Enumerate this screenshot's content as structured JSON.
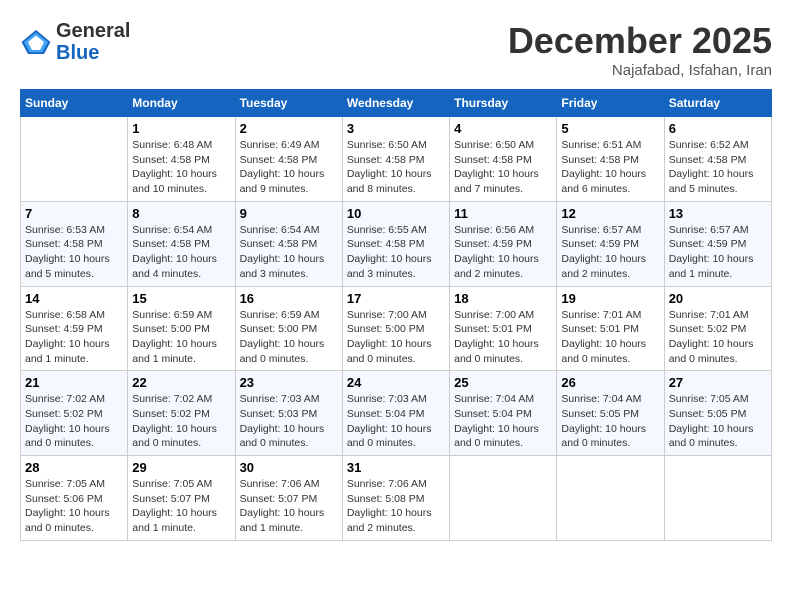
{
  "logo": {
    "general": "General",
    "blue": "Blue"
  },
  "title": "December 2025",
  "location": "Najafabad, Isfahan, Iran",
  "days_of_week": [
    "Sunday",
    "Monday",
    "Tuesday",
    "Wednesday",
    "Thursday",
    "Friday",
    "Saturday"
  ],
  "weeks": [
    [
      {
        "num": "",
        "sunrise": "",
        "sunset": "",
        "daylight": ""
      },
      {
        "num": "1",
        "sunrise": "6:48 AM",
        "sunset": "4:58 PM",
        "daylight": "10 hours and 10 minutes."
      },
      {
        "num": "2",
        "sunrise": "6:49 AM",
        "sunset": "4:58 PM",
        "daylight": "10 hours and 9 minutes."
      },
      {
        "num": "3",
        "sunrise": "6:50 AM",
        "sunset": "4:58 PM",
        "daylight": "10 hours and 8 minutes."
      },
      {
        "num": "4",
        "sunrise": "6:50 AM",
        "sunset": "4:58 PM",
        "daylight": "10 hours and 7 minutes."
      },
      {
        "num": "5",
        "sunrise": "6:51 AM",
        "sunset": "4:58 PM",
        "daylight": "10 hours and 6 minutes."
      },
      {
        "num": "6",
        "sunrise": "6:52 AM",
        "sunset": "4:58 PM",
        "daylight": "10 hours and 5 minutes."
      }
    ],
    [
      {
        "num": "7",
        "sunrise": "6:53 AM",
        "sunset": "4:58 PM",
        "daylight": "10 hours and 5 minutes."
      },
      {
        "num": "8",
        "sunrise": "6:54 AM",
        "sunset": "4:58 PM",
        "daylight": "10 hours and 4 minutes."
      },
      {
        "num": "9",
        "sunrise": "6:54 AM",
        "sunset": "4:58 PM",
        "daylight": "10 hours and 3 minutes."
      },
      {
        "num": "10",
        "sunrise": "6:55 AM",
        "sunset": "4:58 PM",
        "daylight": "10 hours and 3 minutes."
      },
      {
        "num": "11",
        "sunrise": "6:56 AM",
        "sunset": "4:59 PM",
        "daylight": "10 hours and 2 minutes."
      },
      {
        "num": "12",
        "sunrise": "6:57 AM",
        "sunset": "4:59 PM",
        "daylight": "10 hours and 2 minutes."
      },
      {
        "num": "13",
        "sunrise": "6:57 AM",
        "sunset": "4:59 PM",
        "daylight": "10 hours and 1 minute."
      }
    ],
    [
      {
        "num": "14",
        "sunrise": "6:58 AM",
        "sunset": "4:59 PM",
        "daylight": "10 hours and 1 minute."
      },
      {
        "num": "15",
        "sunrise": "6:59 AM",
        "sunset": "5:00 PM",
        "daylight": "10 hours and 1 minute."
      },
      {
        "num": "16",
        "sunrise": "6:59 AM",
        "sunset": "5:00 PM",
        "daylight": "10 hours and 0 minutes."
      },
      {
        "num": "17",
        "sunrise": "7:00 AM",
        "sunset": "5:00 PM",
        "daylight": "10 hours and 0 minutes."
      },
      {
        "num": "18",
        "sunrise": "7:00 AM",
        "sunset": "5:01 PM",
        "daylight": "10 hours and 0 minutes."
      },
      {
        "num": "19",
        "sunrise": "7:01 AM",
        "sunset": "5:01 PM",
        "daylight": "10 hours and 0 minutes."
      },
      {
        "num": "20",
        "sunrise": "7:01 AM",
        "sunset": "5:02 PM",
        "daylight": "10 hours and 0 minutes."
      }
    ],
    [
      {
        "num": "21",
        "sunrise": "7:02 AM",
        "sunset": "5:02 PM",
        "daylight": "10 hours and 0 minutes."
      },
      {
        "num": "22",
        "sunrise": "7:02 AM",
        "sunset": "5:02 PM",
        "daylight": "10 hours and 0 minutes."
      },
      {
        "num": "23",
        "sunrise": "7:03 AM",
        "sunset": "5:03 PM",
        "daylight": "10 hours and 0 minutes."
      },
      {
        "num": "24",
        "sunrise": "7:03 AM",
        "sunset": "5:04 PM",
        "daylight": "10 hours and 0 minutes."
      },
      {
        "num": "25",
        "sunrise": "7:04 AM",
        "sunset": "5:04 PM",
        "daylight": "10 hours and 0 minutes."
      },
      {
        "num": "26",
        "sunrise": "7:04 AM",
        "sunset": "5:05 PM",
        "daylight": "10 hours and 0 minutes."
      },
      {
        "num": "27",
        "sunrise": "7:05 AM",
        "sunset": "5:05 PM",
        "daylight": "10 hours and 0 minutes."
      }
    ],
    [
      {
        "num": "28",
        "sunrise": "7:05 AM",
        "sunset": "5:06 PM",
        "daylight": "10 hours and 0 minutes."
      },
      {
        "num": "29",
        "sunrise": "7:05 AM",
        "sunset": "5:07 PM",
        "daylight": "10 hours and 1 minute."
      },
      {
        "num": "30",
        "sunrise": "7:06 AM",
        "sunset": "5:07 PM",
        "daylight": "10 hours and 1 minute."
      },
      {
        "num": "31",
        "sunrise": "7:06 AM",
        "sunset": "5:08 PM",
        "daylight": "10 hours and 2 minutes."
      },
      {
        "num": "",
        "sunrise": "",
        "sunset": "",
        "daylight": ""
      },
      {
        "num": "",
        "sunrise": "",
        "sunset": "",
        "daylight": ""
      },
      {
        "num": "",
        "sunrise": "",
        "sunset": "",
        "daylight": ""
      }
    ]
  ]
}
